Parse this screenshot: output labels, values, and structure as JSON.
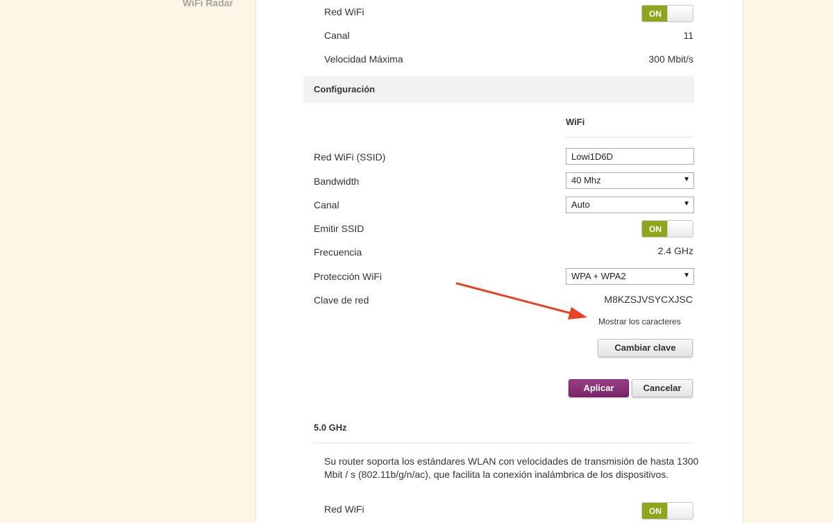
{
  "sidebar": {
    "wifi_radar": "WiFi Radar"
  },
  "top_status": {
    "red_wifi_label": "Red WiFi",
    "red_wifi_toggle": "ON",
    "canal_label": "Canal",
    "canal_value": "11",
    "velocidad_label": "Velocidad Máxima",
    "velocidad_value": "300 Mbit/s"
  },
  "config": {
    "title": "Configuración",
    "column_title": "WiFi",
    "ssid_label": "Red WiFi (SSID)",
    "ssid_value": "Lowi1D6D",
    "bandwidth_label": "Bandwidth",
    "bandwidth_value": "40 Mhz",
    "canal_label": "Canal",
    "canal_value": "Auto",
    "emitir_label": "Emitir SSID",
    "emitir_toggle": "ON",
    "frecuencia_label": "Frecuencia",
    "frecuencia_value": "2.4 GHz",
    "proteccion_label": "Protección WiFi",
    "proteccion_value": "WPA + WPA2",
    "clave_label": "Clave de red",
    "clave_value": "M8KZSJVSYCXJSC",
    "mostrar_link": "Mostrar los caracteres",
    "cambiar_button": "Cambiar clave",
    "aplicar_button": "Aplicar",
    "cancelar_button": "Cancelar"
  },
  "band5": {
    "title": "5.0 GHz",
    "description_line1": "Su router soporta los estándares WLAN con velocidades de transmisión de hasta 1300",
    "description_line2": "Mbit / s (802.11b/g/n/ac), que facilita la conexión inalámbrica de los dispositivos.",
    "red_wifi_label": "Red WiFi",
    "red_wifi_toggle": "ON"
  },
  "colors": {
    "page_background": "#fdf6e7",
    "toggle_on": "#8fa61c",
    "primary_button": "#7a2569",
    "annotation_arrow": "#e8432a"
  },
  "icons": {
    "select_caret": "▼",
    "annotation": "red-arrow-icon"
  }
}
